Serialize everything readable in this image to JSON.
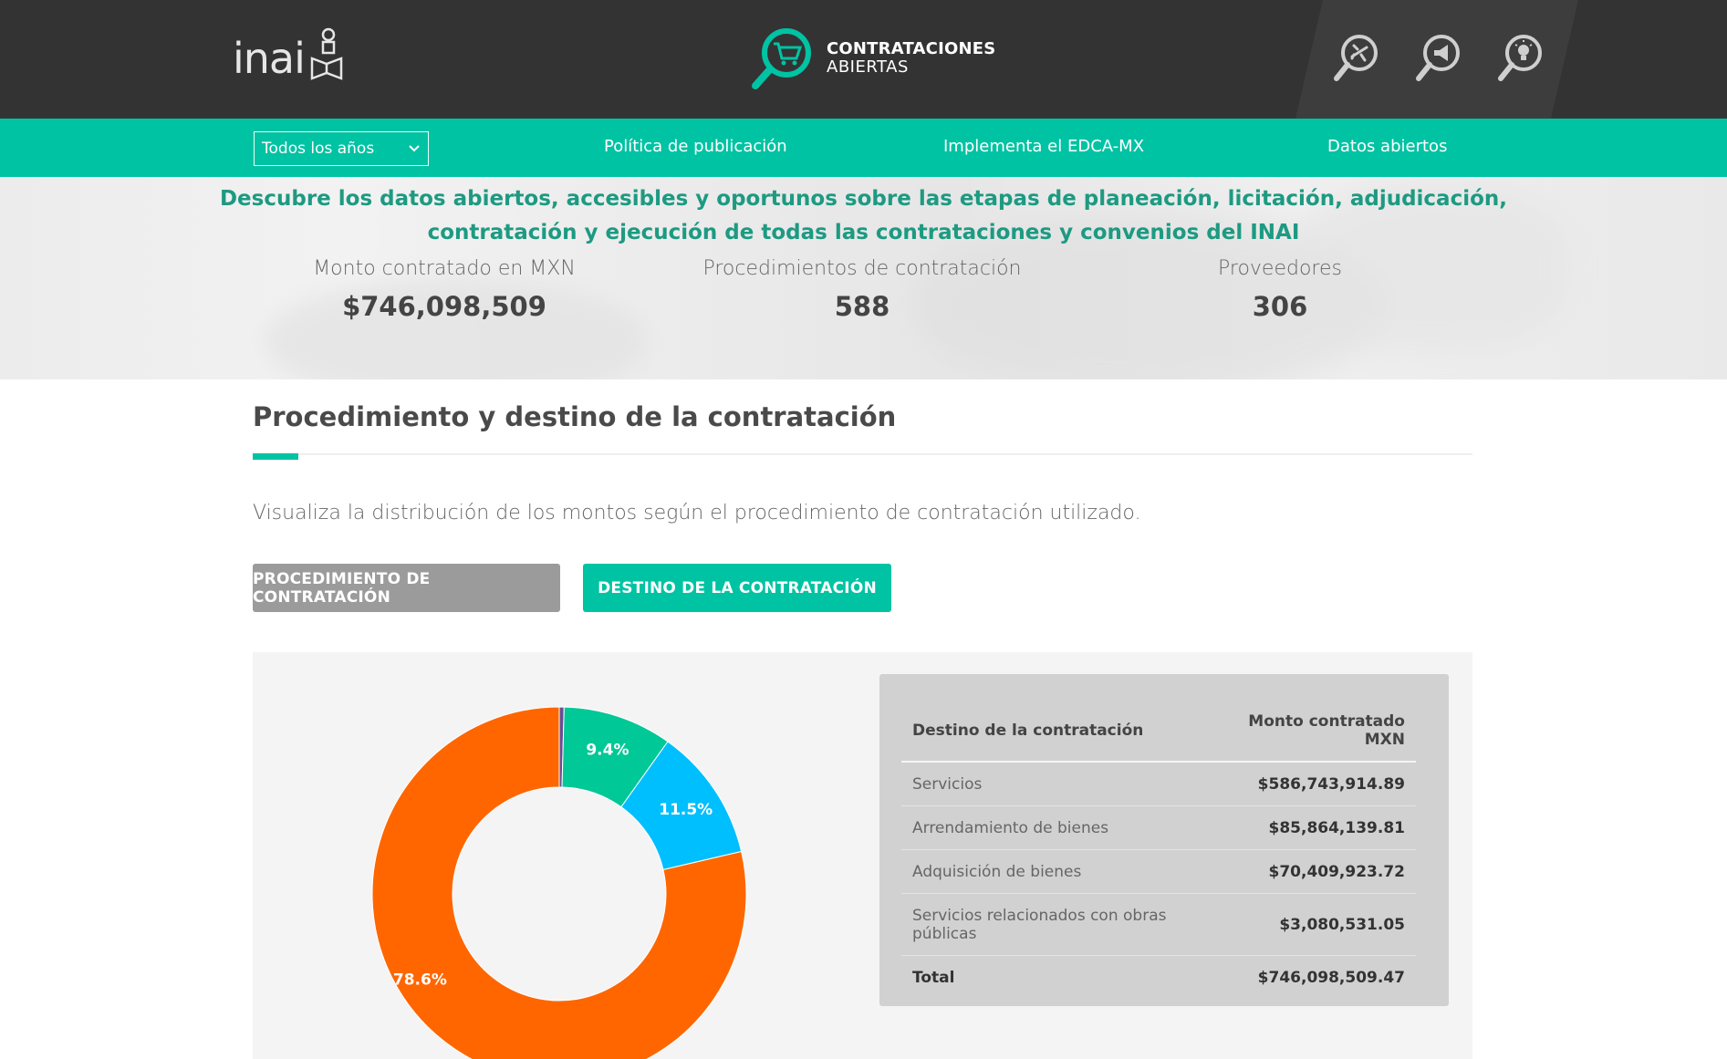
{
  "header": {
    "logo_text": "inai",
    "brand_line1": "CONTRATACIONES",
    "brand_line2": "ABIERTAS",
    "icons": [
      "plane-search-icon",
      "megaphone-search-icon",
      "lightbulb-search-icon"
    ]
  },
  "nav": {
    "year_select": "Todos los años",
    "links": [
      "Política de publicación",
      "Implementa el EDCA-MX",
      "Datos abiertos"
    ]
  },
  "hero": {
    "line1": "Descubre los datos abiertos, accesibles y oportunos sobre las etapas de planeación, licitación, adjudicación,",
    "line2": "contratación y ejecución de todas las contrataciones y convenios del INAI",
    "stats": [
      {
        "label": "Monto contratado en MXN",
        "value": "$746,098,509"
      },
      {
        "label": "Procedimientos de contratación",
        "value": "588"
      },
      {
        "label": "Proveedores",
        "value": "306"
      }
    ]
  },
  "section": {
    "title": "Procedimiento y destino de la contratación",
    "description": "Visualiza la distribución de los montos según el procedimiento de contratación utilizado.",
    "btn_procedimiento": "PROCEDIMIENTO DE CONTRATACIÓN",
    "btn_destino": "DESTINO DE LA CONTRATACIÓN"
  },
  "table": {
    "col1": "Destino de la contratación",
    "col2": "Monto contratado MXN",
    "rows": [
      {
        "label": "Servicios",
        "value": "$586,743,914.89"
      },
      {
        "label": "Arrendamiento de bienes",
        "value": "$85,864,139.81"
      },
      {
        "label": "Adquisición de bienes",
        "value": "$70,409,923.72"
      },
      {
        "label": "Servicios relacionados con obras públicas",
        "value": "$3,080,531.05"
      }
    ],
    "total_label": "Total",
    "total_value": "$746,098,509.47"
  },
  "chart_data": {
    "type": "pie",
    "donut": true,
    "categories": [
      "Servicios relacionados con obras públicas",
      "Adquisición de bienes",
      "Arrendamiento de bienes",
      "Servicios"
    ],
    "values": [
      3080531.05,
      70409923.72,
      85864139.81,
      586743914.89
    ],
    "percent_labels": [
      "",
      "9.4%",
      "11.5%",
      "78.6%"
    ],
    "colors": [
      "#6a4c93",
      "#00c896",
      "#00bfff",
      "#ff6600"
    ]
  }
}
